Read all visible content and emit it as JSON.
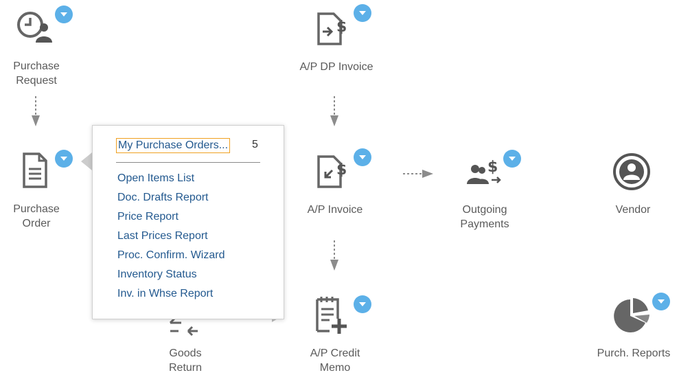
{
  "nodes": {
    "purchase_request": {
      "label_line1": "Purchase",
      "label_line2": "Request"
    },
    "purchase_order": {
      "label_line1": "Purchase",
      "label_line2": "Order"
    },
    "ap_dp_invoice": {
      "label": "A/P DP Invoice"
    },
    "ap_invoice": {
      "label": "A/P Invoice"
    },
    "outgoing_payments": {
      "label_line1": "Outgoing",
      "label_line2": "Payments"
    },
    "vendor": {
      "label": "Vendor"
    },
    "goods_return": {
      "label_line1": "Goods",
      "label_line2": "Return"
    },
    "ap_credit_memo": {
      "label_line1": "A/P Credit",
      "label_line2": "Memo"
    },
    "purch_reports": {
      "label": "Purch. Reports"
    }
  },
  "popup": {
    "primary_item": "My Purchase Orders...",
    "primary_count": "5",
    "items": [
      "Open Items List",
      "Doc. Drafts Report",
      "Price Report",
      "Last Prices Report",
      "Proc. Confirm. Wizard",
      "Inventory Status",
      "Inv. in Whse Report"
    ]
  },
  "colors": {
    "icon_gray": "#666666",
    "badge_blue": "#5cb0e8",
    "link_blue": "#23598f",
    "focus_orange": "#f0a020",
    "arrow_gray": "#8c8c8c"
  },
  "icons": {
    "purchase_request": "clock-person-icon",
    "purchase_order": "document-icon",
    "ap_dp_invoice": "document-dollar-arrow-icon",
    "ap_invoice": "document-dollar-return-icon",
    "outgoing_payments": "people-dollar-icon",
    "vendor": "user-circle-icon",
    "goods_return": "goods-return-icon",
    "ap_credit_memo": "calendar-plus-icon",
    "purch_reports": "pie-chart-icon"
  }
}
